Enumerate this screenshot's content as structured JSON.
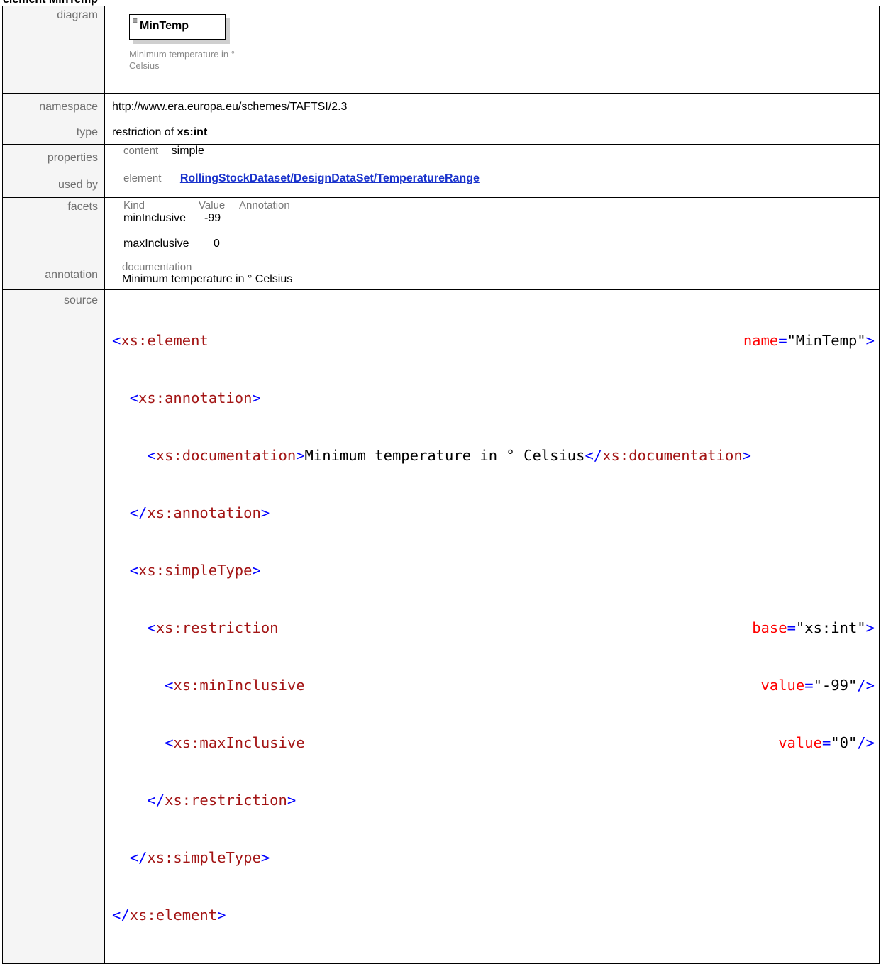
{
  "page_title": "element MinTemp",
  "diagram": {
    "label": "diagram",
    "box_name": "MinTemp",
    "doc_text": "Minimum temperature in ° Celsius"
  },
  "namespace": {
    "label": "namespace",
    "value": "http://www.era.europa.eu/schemes/TAFTSI/2.3"
  },
  "type": {
    "label": "type",
    "prefix": "restriction of ",
    "base": "xs:int"
  },
  "properties": {
    "label": "properties",
    "key": "content",
    "value": "simple"
  },
  "used_by": {
    "label": "used by",
    "kind": "element",
    "link": "RollingStockDataset/DesignDataSet/TemperatureRange"
  },
  "facets": {
    "label": "facets",
    "headers": [
      "Kind",
      "Value",
      "Annotation"
    ],
    "rows": [
      {
        "kind": "minInclusive",
        "value": "-99"
      },
      {
        "kind": "maxInclusive",
        "value": "0"
      }
    ]
  },
  "annotation": {
    "label": "annotation",
    "key": "documentation",
    "value": "Minimum temperature in ° Celsius"
  },
  "source": {
    "label": "source",
    "lines": {
      "l1": "xs:element",
      "l1_attr": "name",
      "l1_val": "\"MinTemp\"",
      "l2": "xs:annotation",
      "l3": "xs:documentation",
      "l3_text": "Minimum temperature in ° Celsius",
      "l3_close": "xs:documentation",
      "l4": "xs:annotation",
      "l5": "xs:simpleType",
      "l6": "xs:restriction",
      "l6_attr": "base",
      "l6_val": "\"xs:int\"",
      "l7": "xs:minInclusive",
      "l7_attr": "value",
      "l7_val": "\"-99\"",
      "l8": "xs:maxInclusive",
      "l8_attr": "value",
      "l8_val": "\"0\"",
      "l9": "xs:restriction",
      "l10": "xs:simpleType",
      "l11": "xs:element"
    }
  },
  "colors": {
    "label_bg": "#f5f5f5",
    "tag": "#a31515",
    "bracket": "#0000ff",
    "attr_name": "#ff0000",
    "attr_value": "#0000ff",
    "link": "#1a33cc"
  }
}
